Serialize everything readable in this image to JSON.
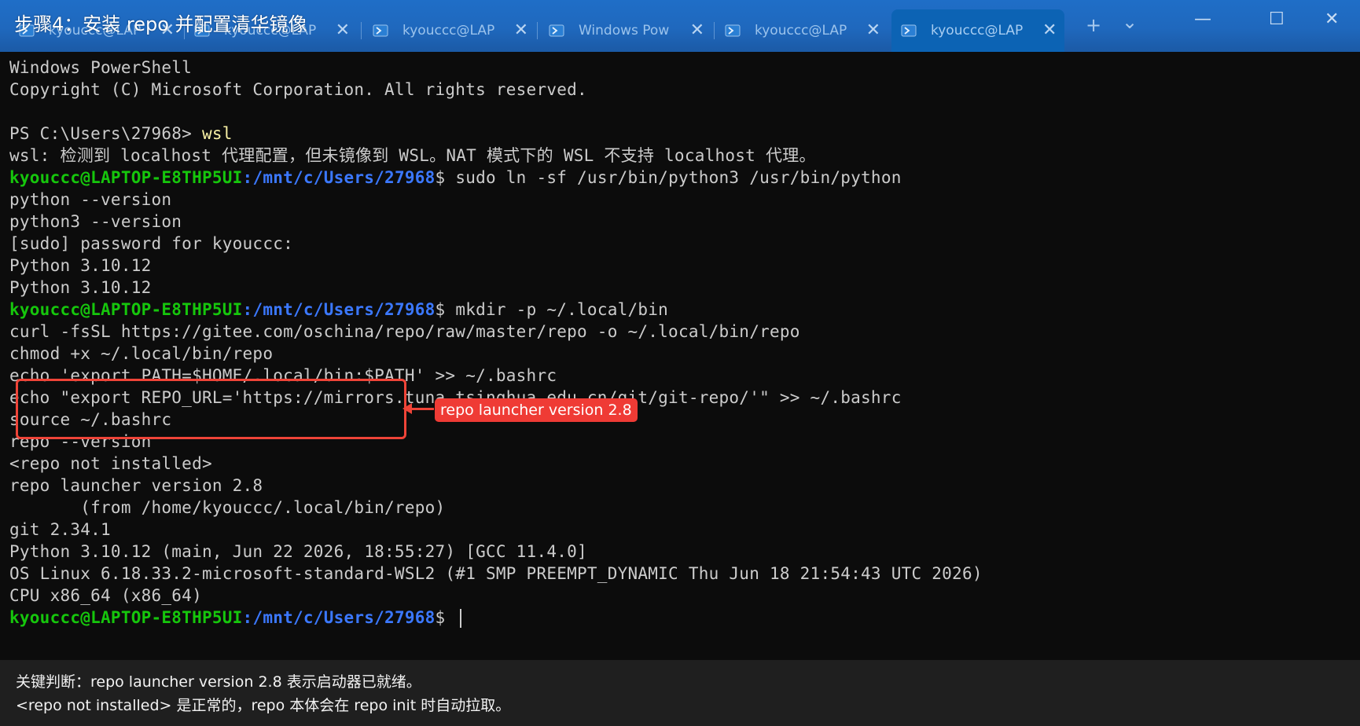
{
  "overlay_title": "步骤4：安装 repo 并配置清华镜像",
  "tabs": [
    {
      "label": "kyouccc@LAP",
      "active": false
    },
    {
      "label": "kyouccc@LAP",
      "active": false
    },
    {
      "label": "kyouccc@LAP",
      "active": false
    },
    {
      "label": "Windows Pow",
      "active": false
    },
    {
      "label": "kyouccc@LAP",
      "active": true
    }
  ],
  "tab_controls": {
    "new_tab": "+",
    "dropdown": "⌄"
  },
  "window_controls": {
    "minimize": "—",
    "maximize": "☐",
    "close": "✕"
  },
  "prompt": {
    "user": "kyouccc@LAPTOP-E8THP5UI",
    "path": ":/mnt/c/Users/27968",
    "symbol": "$"
  },
  "terminal": {
    "l1": "Windows PowerShell",
    "l2": "Copyright (C) Microsoft Corporation. All rights reserved.",
    "l3": "",
    "l4_prompt": "PS C:\\Users\\27968> ",
    "l4_cmd": "wsl",
    "l5": "wsl: 检测到 localhost 代理配置，但未镜像到 WSL。NAT 模式下的 WSL 不支持 localhost 代理。",
    "l6_cmd": " sudo ln -sf /usr/bin/python3 /usr/bin/python",
    "l7": "python --version",
    "l8": "python3 --version",
    "l9": "[sudo] password for kyouccc:",
    "l10": "Python 3.10.12",
    "l11": "Python 3.10.12",
    "l12_cmd": " mkdir -p ~/.local/bin",
    "l13": "curl -fsSL https://gitee.com/oschina/repo/raw/master/repo -o ~/.local/bin/repo",
    "l14": "chmod +x ~/.local/bin/repo",
    "l15": "echo 'export PATH=$HOME/.local/bin:$PATH' >> ~/.bashrc",
    "l16": "echo \"export REPO_URL='https://mirrors.tuna.tsinghua.edu.cn/git/git-repo/'\" >> ~/.bashrc",
    "l17": "source ~/.bashrc",
    "l18": "repo --version",
    "l19": "<repo not installed>",
    "l20": "repo launcher version 2.8",
    "l21": "       (from /home/kyouccc/.local/bin/repo)",
    "l22": "git 2.34.1",
    "l23": "Python 3.10.12 (main, Jun 22 2026, 18:55:27) [GCC 11.4.0]",
    "l24": "OS Linux 6.18.33.2-microsoft-standard-WSL2 (#1 SMP PREEMPT_DYNAMIC Thu Jun 18 21:54:43 UTC 2026)",
    "l25": "CPU x86_64 (x86_64)",
    "l26_cmd": " "
  },
  "annotation": {
    "label": "repo launcher version 2.8",
    "color": "#ef4438"
  },
  "caption": {
    "line1": "关键判断：repo launcher version 2.8 表示启动器已就绪。",
    "line2": "<repo not installed> 是正常的，repo 本体会在 repo init 时自动拉取。"
  },
  "colors": {
    "terminal_bg": "#0c0c0c",
    "terminal_fg": "#cccccc",
    "prompt_user": "#16c60c",
    "prompt_path": "#3b78ff",
    "command_highlight": "#f9f1a5",
    "titlebar": "#1f6ec7"
  }
}
